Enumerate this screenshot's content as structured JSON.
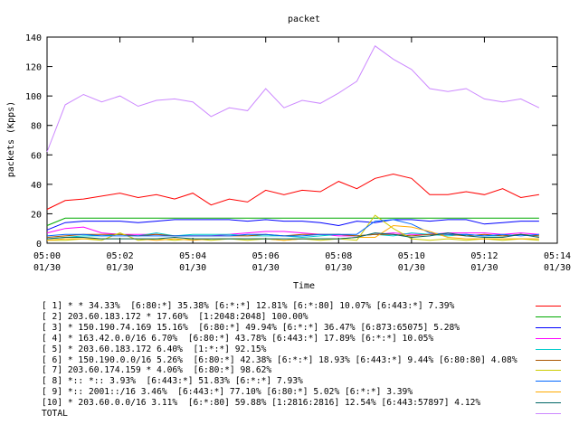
{
  "chart_data": {
    "type": "line",
    "title": "packet",
    "xlabel": "Time",
    "ylabel": "packets (Kpps)",
    "ylim": [
      0,
      140
    ],
    "y_ticks": [
      0,
      20,
      40,
      60,
      80,
      100,
      120,
      140
    ],
    "x_ticks": [
      {
        "time": "05:00",
        "date": "01/30"
      },
      {
        "time": "05:02",
        "date": "01/30"
      },
      {
        "time": "05:04",
        "date": "01/30"
      },
      {
        "time": "05:06",
        "date": "01/30"
      },
      {
        "time": "05:08",
        "date": "01/30"
      },
      {
        "time": "05:10",
        "date": "01/30"
      },
      {
        "time": "05:12",
        "date": "01/30"
      },
      {
        "time": "05:14",
        "date": "01/30"
      }
    ],
    "xlim": [
      "05:00",
      "05:14"
    ],
    "x": [
      "05:00:00",
      "05:00:30",
      "05:01:00",
      "05:01:30",
      "05:02:00",
      "05:02:30",
      "05:03:00",
      "05:03:30",
      "05:04:00",
      "05:04:30",
      "05:05:00",
      "05:05:30",
      "05:06:00",
      "05:06:30",
      "05:07:00",
      "05:07:30",
      "05:08:00",
      "05:08:30",
      "05:09:00",
      "05:09:30",
      "05:10:00",
      "05:10:30",
      "05:11:00",
      "05:11:30",
      "05:12:00",
      "05:12:30",
      "05:13:00",
      "05:13:30"
    ],
    "series": [
      {
        "name": "[ 1] * * 34.33%  [6:80:*] 35.38% [6:*:*] 12.81% [6:*:80] 10.07% [6:443:*] 7.39%",
        "color": "#ff0000",
        "values": [
          23,
          29,
          30,
          32,
          34,
          31,
          33,
          30,
          34,
          26,
          30,
          28,
          36,
          33,
          36,
          35,
          42,
          37,
          44,
          47,
          44,
          33,
          33,
          35,
          33,
          37,
          31,
          33
        ]
      },
      {
        "name": "[ 2] 203.60.183.172 * 17.60%  [1:2048:2048] 100.00%",
        "color": "#00aa00",
        "values": [
          12,
          17,
          17,
          17,
          17,
          17,
          17,
          17,
          17,
          17,
          17,
          17,
          17,
          17,
          17,
          17,
          17,
          17,
          17,
          17,
          17,
          17,
          17,
          17,
          17,
          17,
          17,
          17
        ]
      },
      {
        "name": "[ 3] * 150.190.74.169 15.16%  [6:80:*] 49.94% [6:*:*] 36.47% [6:873:65075] 5.28%",
        "color": "#0000ff",
        "values": [
          9,
          14,
          15,
          15,
          15,
          14,
          15,
          16,
          16,
          16,
          16,
          15,
          16,
          15,
          15,
          14,
          12,
          15,
          14,
          16,
          16,
          15,
          16,
          16,
          13,
          14,
          15,
          15
        ]
      },
      {
        "name": "[ 4] * 163.42.0.0/16 6.70%  [6:80:*] 43.78% [6:443:*] 17.89% [6:*:*] 10.05%",
        "color": "#ff00ff",
        "values": [
          7,
          10,
          11,
          7,
          6,
          6,
          6,
          5,
          5,
          5,
          6,
          7,
          8,
          8,
          7,
          6,
          5,
          5,
          6,
          7,
          6,
          6,
          7,
          7,
          7,
          6,
          7,
          6
        ]
      },
      {
        "name": "[ 5] * 203.60.183.172 6.40%  [1:*:*] 92.15%",
        "color": "#00cccc",
        "values": [
          3,
          4,
          5,
          5,
          6,
          5,
          7,
          5,
          6,
          6,
          6,
          5,
          5,
          5,
          4,
          5,
          6,
          5,
          6,
          5,
          7,
          6,
          5,
          6,
          5,
          5,
          6,
          5
        ]
      },
      {
        "name": "[ 6] * 150.190.0.0/16 5.26%  [6:80:*] 42.38% [6:*:*] 18.93% [6:443:*] 9.44% [6:80:80] 4.08%",
        "color": "#aa5500",
        "values": [
          4,
          5,
          6,
          6,
          6,
          5,
          6,
          5,
          5,
          5,
          5,
          5,
          6,
          5,
          6,
          6,
          6,
          5,
          6,
          6,
          5,
          6,
          6,
          5,
          6,
          5,
          6,
          5
        ]
      },
      {
        "name": "[ 7] 203.60.174.159 * 4.06%  [6:80:*] 98.62%",
        "color": "#cccc00",
        "values": [
          2,
          2,
          3,
          2,
          7,
          2,
          3,
          2,
          3,
          2,
          3,
          2,
          3,
          2,
          3,
          2,
          3,
          2,
          19,
          10,
          3,
          2,
          3,
          2,
          3,
          2,
          3,
          2
        ]
      },
      {
        "name": "[ 8] *:: *:: 3.93%  [6:443:*] 51.83% [6:*:*] 7.93%",
        "color": "#0066ff",
        "values": [
          5,
          6,
          6,
          5,
          5,
          5,
          5,
          5,
          5,
          5,
          5,
          6,
          6,
          5,
          5,
          6,
          6,
          6,
          15,
          16,
          13,
          7,
          6,
          6,
          5,
          6,
          5,
          6
        ]
      },
      {
        "name": "[ 9] *:: 2001::/16 3.46%  [6:443:*] 77.10% [6:80:*] 5.02% [6:*:*] 3.39%",
        "color": "#ffaa00",
        "values": [
          2,
          3,
          3,
          3,
          3,
          3,
          2,
          3,
          2,
          3,
          3,
          3,
          3,
          2,
          3,
          3,
          3,
          4,
          4,
          12,
          11,
          8,
          4,
          3,
          3,
          3,
          3,
          3
        ]
      },
      {
        "name": "[10] * 203.60.0.0/16 3.11%  [6:*:80] 59.88% [1:2816:2816] 12.54% [6:443:57897] 4.12%",
        "color": "#006666",
        "values": [
          3,
          4,
          4,
          3,
          3,
          3,
          3,
          4,
          3,
          3,
          3,
          3,
          3,
          3,
          3,
          3,
          3,
          4,
          7,
          6,
          4,
          5,
          7,
          5,
          4,
          4,
          6,
          4
        ]
      },
      {
        "name": "TOTAL",
        "color": "#cc88ff",
        "values": [
          62,
          94,
          101,
          96,
          100,
          93,
          97,
          98,
          96,
          86,
          92,
          90,
          105,
          92,
          97,
          95,
          102,
          110,
          134,
          125,
          118,
          105,
          103,
          105,
          98,
          96,
          98,
          92
        ]
      }
    ]
  }
}
